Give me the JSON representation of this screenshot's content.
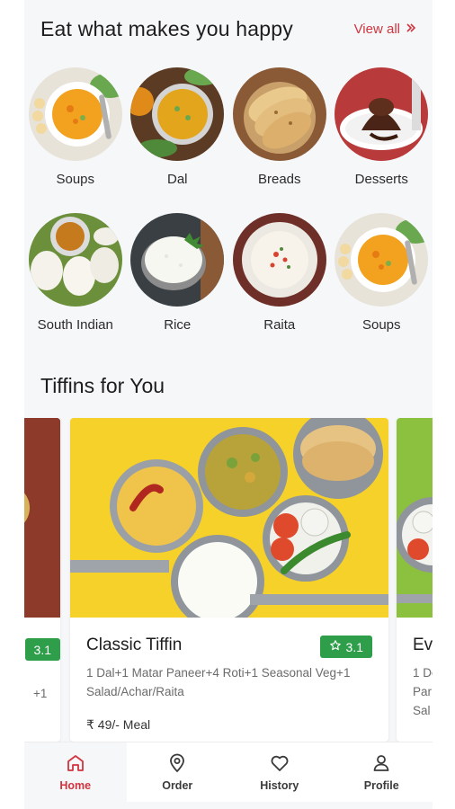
{
  "section_categories": {
    "title": "Eat what makes you happy",
    "view_all_label": "View all",
    "view_all_icon": "double-chevron-right-icon"
  },
  "categories": [
    {
      "label": "Soups",
      "image": "soup-bowl"
    },
    {
      "label": "Dal",
      "image": "dal-bowl"
    },
    {
      "label": "Breads",
      "image": "roti-stack"
    },
    {
      "label": "Desserts",
      "image": "chocolate-lava-cake"
    },
    {
      "label": "South Indian",
      "image": "idli-sambar"
    },
    {
      "label": "Rice",
      "image": "rice-bowl"
    },
    {
      "label": "Raita",
      "image": "raita-bowl"
    },
    {
      "label": "Soups",
      "image": "soup-bowl"
    }
  ],
  "section_tiffins": {
    "title": "Tiffins for You"
  },
  "tiffins": [
    {
      "name": "",
      "rating": "3.1",
      "desc": "+1",
      "price": ""
    },
    {
      "name": "Classic Tiffin",
      "rating": "3.1",
      "rating_icon": "star-outline-icon",
      "desc": "1 Dal+1 Matar Paneer+4 Roti+1 Seasonal Veg+1 Salad/Achar/Raita",
      "price": "₹ 49/- Meal"
    },
    {
      "name": "Ev",
      "desc_lines": [
        "1 Do",
        "Par",
        "Sal"
      ]
    }
  ],
  "bottom_nav": [
    {
      "label": "Home",
      "icon": "home-icon",
      "active": true
    },
    {
      "label": "Order",
      "icon": "location-pin-icon",
      "active": false
    },
    {
      "label": "History",
      "icon": "heart-icon",
      "active": false
    },
    {
      "label": "Profile",
      "icon": "person-icon",
      "active": false
    }
  ],
  "colors": {
    "accent": "#d0353f",
    "rating_green": "#2e9e4a",
    "background": "#f6f7f9"
  }
}
